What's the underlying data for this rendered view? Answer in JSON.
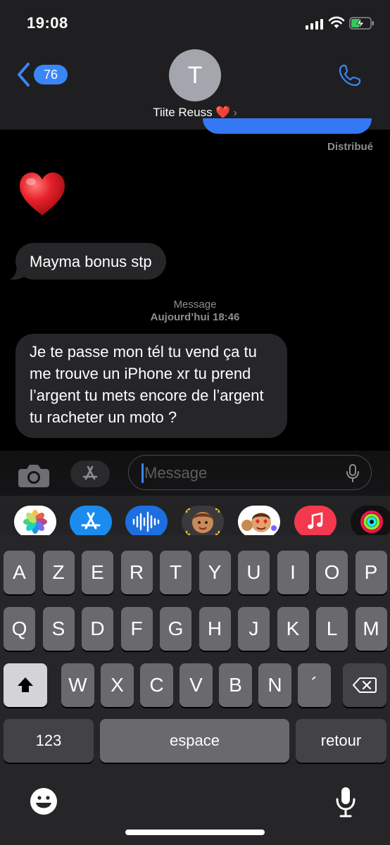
{
  "status_bar": {
    "time": "19:08"
  },
  "header": {
    "back_count": "76",
    "avatar_initial": "T",
    "contact_name": "Tiite Reuss ❤️",
    "chevron": "›",
    "icons": {
      "back": "chevron-left-icon",
      "phone": "phone-icon"
    }
  },
  "conversation": {
    "delivered_label": "Distribué",
    "heart_emoji": "heart-emoji",
    "messages": [
      {
        "direction": "incoming",
        "text": "Mayma bonus stp"
      },
      {
        "direction": "incoming",
        "text": "Je te passe mon tél tu vend ça tu me trouve un iPhone xr tu prend l’argent tu mets encore de l’argent tu racheter un moto ?"
      }
    ],
    "timestamp": {
      "label": "Message",
      "time": "Aujourd’hui 18:46"
    }
  },
  "input": {
    "placeholder": "Message",
    "icons": [
      "camera-icon",
      "app-store-icon",
      "microphone-icon"
    ]
  },
  "app_drawer": {
    "apps": [
      "photos-app-icon",
      "app-store-app-icon",
      "audio-message-app-icon",
      "memoji-app-icon",
      "memoji-stickers-app-icon",
      "music-app-icon",
      "activity-app-icon"
    ]
  },
  "keyboard": {
    "row1": [
      "A",
      "Z",
      "E",
      "R",
      "T",
      "Y",
      "U",
      "I",
      "O",
      "P"
    ],
    "row2": [
      "Q",
      "S",
      "D",
      "F",
      "G",
      "H",
      "J",
      "K",
      "L",
      "M"
    ],
    "row3": [
      "W",
      "X",
      "C",
      "V",
      "B",
      "N",
      "´"
    ],
    "numbers_label": "123",
    "space_label": "espace",
    "return_label": "retour",
    "icons": [
      "shift-icon",
      "backspace-icon",
      "emoji-icon",
      "dictation-mic-icon"
    ]
  },
  "colors": {
    "accent": "#3a86f7",
    "bubble_incoming": "#262629",
    "bubble_outgoing": "#3478f6",
    "key": "#6a6a6e",
    "key_dark": "#434346"
  }
}
